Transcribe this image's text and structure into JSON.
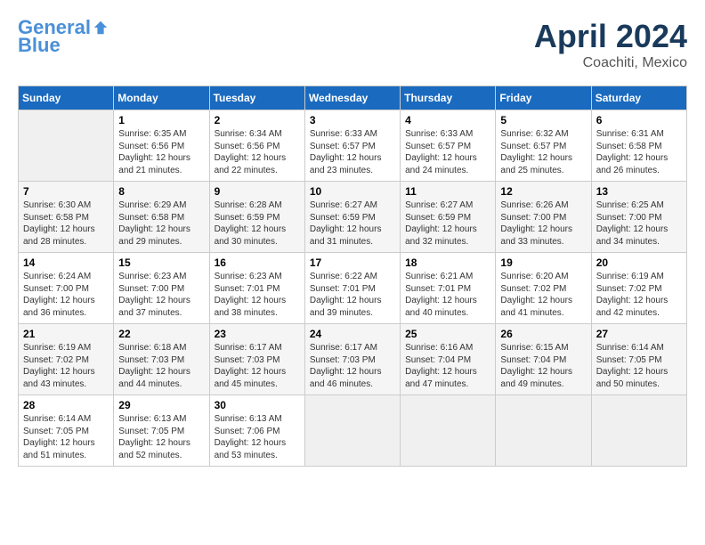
{
  "header": {
    "logo_general": "General",
    "logo_blue": "Blue",
    "month_title": "April 2024",
    "subtitle": "Coachiti, Mexico"
  },
  "days_of_week": [
    "Sunday",
    "Monday",
    "Tuesday",
    "Wednesday",
    "Thursday",
    "Friday",
    "Saturday"
  ],
  "weeks": [
    [
      {
        "day": "",
        "empty": true
      },
      {
        "day": "1",
        "sunrise": "Sunrise: 6:35 AM",
        "sunset": "Sunset: 6:56 PM",
        "daylight": "Daylight: 12 hours and 21 minutes."
      },
      {
        "day": "2",
        "sunrise": "Sunrise: 6:34 AM",
        "sunset": "Sunset: 6:56 PM",
        "daylight": "Daylight: 12 hours and 22 minutes."
      },
      {
        "day": "3",
        "sunrise": "Sunrise: 6:33 AM",
        "sunset": "Sunset: 6:57 PM",
        "daylight": "Daylight: 12 hours and 23 minutes."
      },
      {
        "day": "4",
        "sunrise": "Sunrise: 6:33 AM",
        "sunset": "Sunset: 6:57 PM",
        "daylight": "Daylight: 12 hours and 24 minutes."
      },
      {
        "day": "5",
        "sunrise": "Sunrise: 6:32 AM",
        "sunset": "Sunset: 6:57 PM",
        "daylight": "Daylight: 12 hours and 25 minutes."
      },
      {
        "day": "6",
        "sunrise": "Sunrise: 6:31 AM",
        "sunset": "Sunset: 6:58 PM",
        "daylight": "Daylight: 12 hours and 26 minutes."
      }
    ],
    [
      {
        "day": "7",
        "sunrise": "Sunrise: 6:30 AM",
        "sunset": "Sunset: 6:58 PM",
        "daylight": "Daylight: 12 hours and 28 minutes."
      },
      {
        "day": "8",
        "sunrise": "Sunrise: 6:29 AM",
        "sunset": "Sunset: 6:58 PM",
        "daylight": "Daylight: 12 hours and 29 minutes."
      },
      {
        "day": "9",
        "sunrise": "Sunrise: 6:28 AM",
        "sunset": "Sunset: 6:59 PM",
        "daylight": "Daylight: 12 hours and 30 minutes."
      },
      {
        "day": "10",
        "sunrise": "Sunrise: 6:27 AM",
        "sunset": "Sunset: 6:59 PM",
        "daylight": "Daylight: 12 hours and 31 minutes."
      },
      {
        "day": "11",
        "sunrise": "Sunrise: 6:27 AM",
        "sunset": "Sunset: 6:59 PM",
        "daylight": "Daylight: 12 hours and 32 minutes."
      },
      {
        "day": "12",
        "sunrise": "Sunrise: 6:26 AM",
        "sunset": "Sunset: 7:00 PM",
        "daylight": "Daylight: 12 hours and 33 minutes."
      },
      {
        "day": "13",
        "sunrise": "Sunrise: 6:25 AM",
        "sunset": "Sunset: 7:00 PM",
        "daylight": "Daylight: 12 hours and 34 minutes."
      }
    ],
    [
      {
        "day": "14",
        "sunrise": "Sunrise: 6:24 AM",
        "sunset": "Sunset: 7:00 PM",
        "daylight": "Daylight: 12 hours and 36 minutes."
      },
      {
        "day": "15",
        "sunrise": "Sunrise: 6:23 AM",
        "sunset": "Sunset: 7:00 PM",
        "daylight": "Daylight: 12 hours and 37 minutes."
      },
      {
        "day": "16",
        "sunrise": "Sunrise: 6:23 AM",
        "sunset": "Sunset: 7:01 PM",
        "daylight": "Daylight: 12 hours and 38 minutes."
      },
      {
        "day": "17",
        "sunrise": "Sunrise: 6:22 AM",
        "sunset": "Sunset: 7:01 PM",
        "daylight": "Daylight: 12 hours and 39 minutes."
      },
      {
        "day": "18",
        "sunrise": "Sunrise: 6:21 AM",
        "sunset": "Sunset: 7:01 PM",
        "daylight": "Daylight: 12 hours and 40 minutes."
      },
      {
        "day": "19",
        "sunrise": "Sunrise: 6:20 AM",
        "sunset": "Sunset: 7:02 PM",
        "daylight": "Daylight: 12 hours and 41 minutes."
      },
      {
        "day": "20",
        "sunrise": "Sunrise: 6:19 AM",
        "sunset": "Sunset: 7:02 PM",
        "daylight": "Daylight: 12 hours and 42 minutes."
      }
    ],
    [
      {
        "day": "21",
        "sunrise": "Sunrise: 6:19 AM",
        "sunset": "Sunset: 7:02 PM",
        "daylight": "Daylight: 12 hours and 43 minutes."
      },
      {
        "day": "22",
        "sunrise": "Sunrise: 6:18 AM",
        "sunset": "Sunset: 7:03 PM",
        "daylight": "Daylight: 12 hours and 44 minutes."
      },
      {
        "day": "23",
        "sunrise": "Sunrise: 6:17 AM",
        "sunset": "Sunset: 7:03 PM",
        "daylight": "Daylight: 12 hours and 45 minutes."
      },
      {
        "day": "24",
        "sunrise": "Sunrise: 6:17 AM",
        "sunset": "Sunset: 7:03 PM",
        "daylight": "Daylight: 12 hours and 46 minutes."
      },
      {
        "day": "25",
        "sunrise": "Sunrise: 6:16 AM",
        "sunset": "Sunset: 7:04 PM",
        "daylight": "Daylight: 12 hours and 47 minutes."
      },
      {
        "day": "26",
        "sunrise": "Sunrise: 6:15 AM",
        "sunset": "Sunset: 7:04 PM",
        "daylight": "Daylight: 12 hours and 49 minutes."
      },
      {
        "day": "27",
        "sunrise": "Sunrise: 6:14 AM",
        "sunset": "Sunset: 7:05 PM",
        "daylight": "Daylight: 12 hours and 50 minutes."
      }
    ],
    [
      {
        "day": "28",
        "sunrise": "Sunrise: 6:14 AM",
        "sunset": "Sunset: 7:05 PM",
        "daylight": "Daylight: 12 hours and 51 minutes."
      },
      {
        "day": "29",
        "sunrise": "Sunrise: 6:13 AM",
        "sunset": "Sunset: 7:05 PM",
        "daylight": "Daylight: 12 hours and 52 minutes."
      },
      {
        "day": "30",
        "sunrise": "Sunrise: 6:13 AM",
        "sunset": "Sunset: 7:06 PM",
        "daylight": "Daylight: 12 hours and 53 minutes."
      },
      {
        "day": "",
        "empty": true
      },
      {
        "day": "",
        "empty": true
      },
      {
        "day": "",
        "empty": true
      },
      {
        "day": "",
        "empty": true
      }
    ]
  ]
}
